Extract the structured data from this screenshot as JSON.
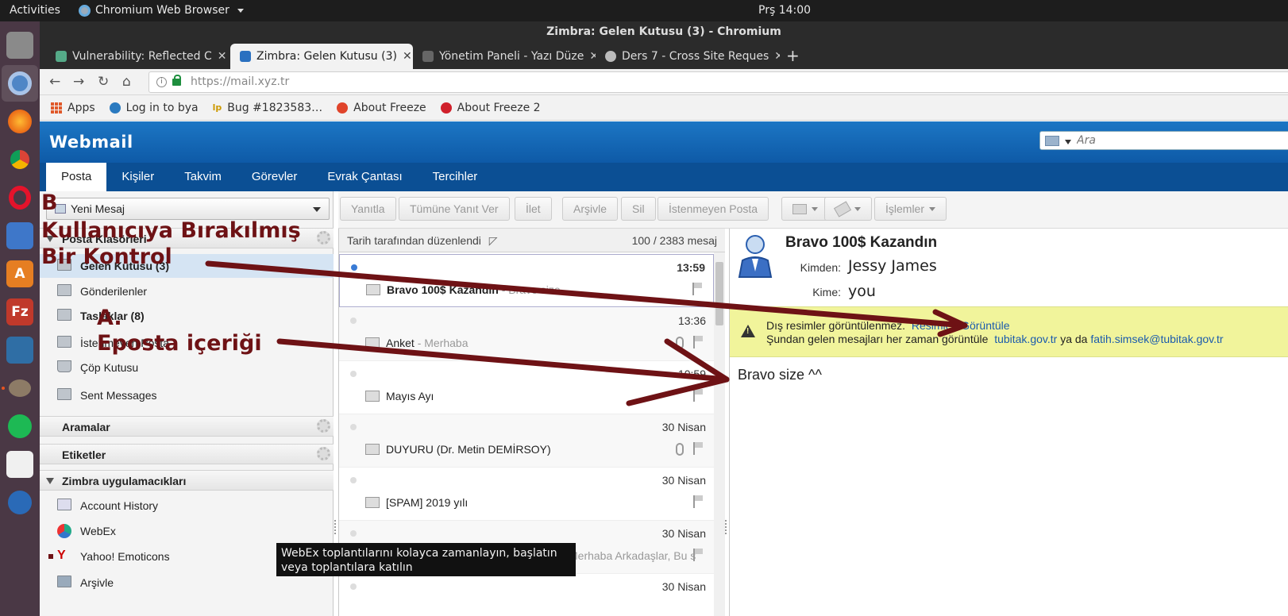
{
  "system": {
    "activities": "Activities",
    "app_name": "Chromium Web Browser",
    "clock": "Prş 14:00"
  },
  "browser": {
    "window_title": "Zimbra: Gelen Kutusu (3) - Chromium",
    "tabs": [
      {
        "label": "Vulnerability: Reflected C"
      },
      {
        "label": "Zimbra: Gelen Kutusu (3)"
      },
      {
        "label": "Yönetim Paneli - Yazı Düze"
      },
      {
        "label": "Ders 7 - Cross Site Reques"
      }
    ],
    "url": "https://mail.xyz.tr",
    "bookmarks": [
      {
        "label": "Apps"
      },
      {
        "label": "Log in to bya"
      },
      {
        "label": "Bug #1823583…"
      },
      {
        "label": "About Freeze"
      },
      {
        "label": "About Freeze 2"
      }
    ]
  },
  "webmail": {
    "logo": "Webmail",
    "search_placeholder": "Ara",
    "nav_tabs": [
      {
        "label": "Posta"
      },
      {
        "label": "Kişiler"
      },
      {
        "label": "Takvim"
      },
      {
        "label": "Görevler"
      },
      {
        "label": "Evrak Çantası"
      },
      {
        "label": "Tercihler"
      }
    ],
    "new_message": "Yeni Mesaj",
    "sections": {
      "folders": "Posta Klasörleri",
      "searches": "Aramalar",
      "tags": "Etiketler",
      "zimlets": "Zimbra uygulamacıkları"
    },
    "folders": [
      {
        "label": "Gelen Kutusu (3)"
      },
      {
        "label": "Gönderilenler"
      },
      {
        "label": "Taslaklar (8)"
      },
      {
        "label": "İstenmeyen Posta"
      },
      {
        "label": "Çöp Kutusu"
      },
      {
        "label": "Sent Messages"
      }
    ],
    "zimlets": [
      {
        "label": "Account History"
      },
      {
        "label": "WebEx"
      },
      {
        "label": "Yahoo! Emoticons"
      },
      {
        "label": "Arşivle"
      }
    ],
    "actions": {
      "reply": "Yanıtla",
      "reply_all": "Tümüne Yanıt Ver",
      "forward": "İlet",
      "archive": "Arşivle",
      "delete": "Sil",
      "spam": "İstenmeyen Posta",
      "operations": "İşlemler"
    },
    "list": {
      "sort_label": "Tarih tarafından düzenlendi",
      "count": "100 / 2383 mesaj",
      "messages": [
        {
          "date": "13:59",
          "subject": "Bravo 100$ Kazandın",
          "preview": " - Bravo size"
        },
        {
          "date": "13:36",
          "subject": "Anket",
          "preview": " - Merhaba"
        },
        {
          "date": "10:59",
          "subject": "Mayıs Ayı",
          "preview": ""
        },
        {
          "date": "30 Nisan",
          "subject": "DUYURU (Dr. Metin DEMİRSOY)",
          "preview": ""
        },
        {
          "date": "30 Nisan",
          "subject": "[SPAM] 2019 yılı",
          "preview": ""
        },
        {
          "date": "30 Nisan",
          "subject": "",
          "preview": "Merhaba Arkadaşlar, Bu s"
        },
        {
          "date": "30 Nisan",
          "subject": "",
          "preview": ""
        }
      ]
    },
    "reading": {
      "subject": "Bravo 100$ Kazandın",
      "from_label": "Kimden:",
      "from": "Jessy James",
      "to_label": "Kime:",
      "to": "you",
      "warn_line1": "Dış resimler görüntülenmez.",
      "warn_link1": "Resimleri Görüntüle",
      "warn_line2": "Şundan gelen mesajları her zaman görüntüle",
      "warn_link2": "tubitak.gov.tr",
      "warn_or": "ya da",
      "warn_link3": "fatih.simsek@tubitak.gov.tr",
      "body": "Bravo size ^^"
    },
    "tooltip": "WebEx toplantılarını kolayca zamanlayın, başlatın veya toplantılara katılın"
  },
  "annotations": {
    "b_label": "B",
    "b_line1": "Kullanıcıya Bırakılmış",
    "b_line2": "Bir Kontrol",
    "a_label": "A.",
    "a_line": "Eposta içeriği",
    "color": "#6e1215"
  }
}
